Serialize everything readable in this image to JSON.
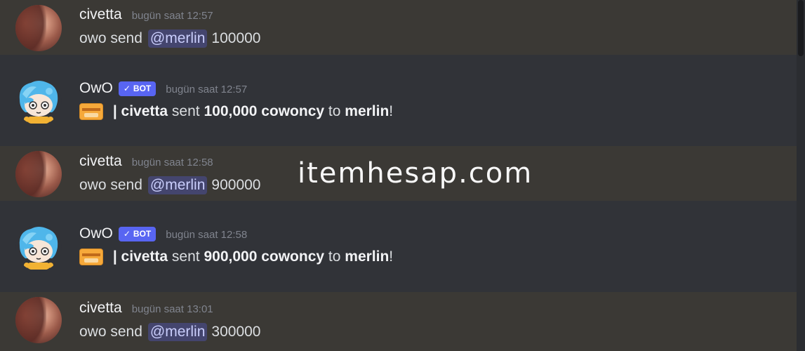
{
  "messages": [
    {
      "author": "civetta",
      "timestamp": "bugün saat 12:57",
      "prefix": "owo send",
      "mention": "@merlin",
      "amount": "100000"
    },
    {
      "author": "OwO",
      "bot_label": "BOT",
      "timestamp": "bugün saat 12:57",
      "sep": " | ",
      "sender": "civetta",
      "sent_word": " sent ",
      "amount": "100,000 cowoncy",
      "to_word": " to ",
      "recipient": "merlin",
      "end": "!"
    },
    {
      "author": "civetta",
      "timestamp": "bugün saat 12:58",
      "prefix": "owo send",
      "mention": "@merlin",
      "amount": "900000"
    },
    {
      "author": "OwO",
      "bot_label": "BOT",
      "timestamp": "bugün saat 12:58",
      "sep": " | ",
      "sender": "civetta",
      "sent_word": " sent ",
      "amount": "900,000 cowoncy",
      "to_word": " to ",
      "recipient": "merlin",
      "end": "!"
    },
    {
      "author": "civetta",
      "timestamp": "bugün saat 13:01",
      "prefix": "owo send",
      "mention": "@merlin",
      "amount": "300000"
    }
  ],
  "watermark": "itemhesap.com",
  "icons": {
    "user_avatar": "user-avatar",
    "bot_avatar": "bot-avatar",
    "bot_check": "check-icon",
    "card": "credit-card-icon"
  },
  "colors": {
    "background": "#313338",
    "highlight": "#3b3935",
    "bot_tag": "#5865f2",
    "mention_bg": "#3c4270",
    "mention_text": "#c9cdfb"
  }
}
